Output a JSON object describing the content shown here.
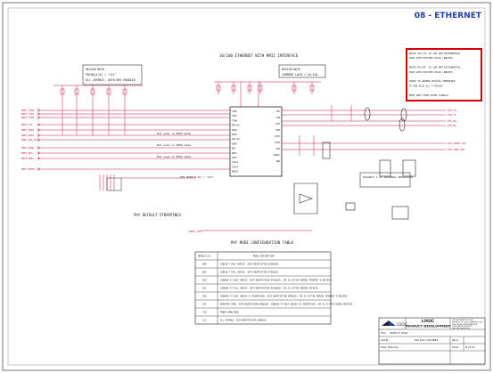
{
  "sheet_title": "08 - ETHERNET",
  "schematic_title": "10/100 ETHERNET WITH RMII INTERFACE",
  "design_notes": {
    "left": [
      "DESIGN NOTE",
      "PHYAD[4:0] = \"111\"",
      "ALL CAPABLE, AUTO-NEG ENABLED"
    ],
    "middle": [
      "DESIGN NOTE",
      "CURRENT LOCK = 16.32A"
    ]
  },
  "red_note": [
    "ROUTE TX+/TX- AS 100 OHM DIFFERENTIAL",
    "PAIR WITH MATCHED TRACE LENGTHS.",
    "",
    "ROUTE RX+/RX- AS 100 OHM DIFFERENTIAL",
    "PAIR WITH MATCHED TRACE LENGTHS.",
    "",
    "PAIRS TO GROUND CHASSIS IMPEDANCE",
    "TO GND PLUS ALL 4 TRACES.",
    "",
    "KEEP AWAY FROM OTHER SIGNALS."
  ],
  "left_signals": [
    "ENET_TXD0",
    "ENET_TXD1",
    "ENET_TXEN",
    "ENET_CLK",
    "ENET_RXD0",
    "ENET_RXD1",
    "ENET_CRS_DV",
    "ENET_RXER",
    "ENET_MDC",
    "ENET_MDIO",
    "ENET_RESET"
  ],
  "right_signals": [
    "ETH_TX+",
    "ETH_TX-",
    "ETH_RX+",
    "ETH_RX-",
    "ETH_SPEED_LED",
    "ETH_LINK_LED"
  ],
  "phy_labels": {
    "left_pins": [
      "TXD0",
      "TXD1",
      "TXEN",
      "REFCLK",
      "RXD0",
      "RXD1",
      "CRS_DV",
      "RXER",
      "MDC",
      "MDIO",
      "nRST",
      "XTAL1",
      "XTAL2",
      "RBIAS"
    ],
    "right_pins": [
      "TXP",
      "TXN",
      "RXP",
      "RXN",
      "LED1",
      "LED2",
      "VDD",
      "VDDIO",
      "GND"
    ]
  },
  "notes_in_diagram": {
    "not_used": "Not used in RMII mode",
    "phy_mode": "PHY MODE[2:0] = \"111\"",
    "strapping": "PHY DEFAULT STRAPPINGS",
    "regulator_note": "DISABLE 1.2V INTERNAL REGULATOR",
    "reset_label": "ENET_RST"
  },
  "mode_table": {
    "title": "PHY MODE CONFIGURATION TABLE",
    "headers": [
      "MODE[2:0]",
      "MODE DEFINITION"
    ],
    "rows": [
      [
        "000",
        "10BASE-T HALF DUPLEX. AUTO-NEGOTIATION DISABLED."
      ],
      [
        "001",
        "10BASE-T FULL DUPLEX. AUTO-NEGOTIATION DISABLED."
      ],
      [
        "010",
        "100BASE-TX HALF DUPLEX. AUTO-NEGOTIATION DISABLED. CRS IS ACTIVE DURING TRANSMIT & RECEIVE."
      ],
      [
        "011",
        "100BASE-TX FULL DUPLEX. AUTO-NEGOTIATION DISABLED. CRS IS ACTIVE DURING RECEIVE."
      ],
      [
        "100",
        "100BASE-TX HALF DUPLEX IS ADVERTISED. AUTO-NEGOTIATION ENABLED. CRS IS ACTIVE DURING TRANSMIT & RECEIVE."
      ],
      [
        "101",
        "REPEATER MODE. AUTO-NEGOTIATION ENABLED. 100BASE-TX HALF DUPLEX IS ADVERTISED. CRS IS ACTIVE DURING RECEIVE."
      ],
      [
        "110",
        "POWER DOWN MODE."
      ],
      [
        "111",
        "ALL CAPABLE. AUTO-NEGOTIATION ENABLED."
      ]
    ]
  },
  "title_block": {
    "company": "LOGIC",
    "department": "PRODUCT DEVELOPMENT",
    "title_label": "Title",
    "title_value": "AM3517 SOM",
    "size_label": "Size",
    "size_value": "B",
    "number_label": "Part Num",
    "number_value": "1013882",
    "rev_label": "Rev",
    "rev_value": "A",
    "date_label": "Date",
    "date_value": "Monday, ...",
    "sheet_label": "Sheet",
    "sheet_value": "8 of 14",
    "notice": [
      "THIS INFORMATION IS THE",
      "PROPERTY OF LOGIC. REPRODUCTION,",
      "DISCLOSURE OR DISTRIBUTION",
      "IS PROHIBITED WITHOUT",
      "WRITTEN PERMISSION."
    ]
  },
  "colors": {
    "wire": "#c8144b",
    "ink": "#202020",
    "title_blue": "#1e3ea8",
    "red_box": "#d60000",
    "border": "#333333"
  }
}
